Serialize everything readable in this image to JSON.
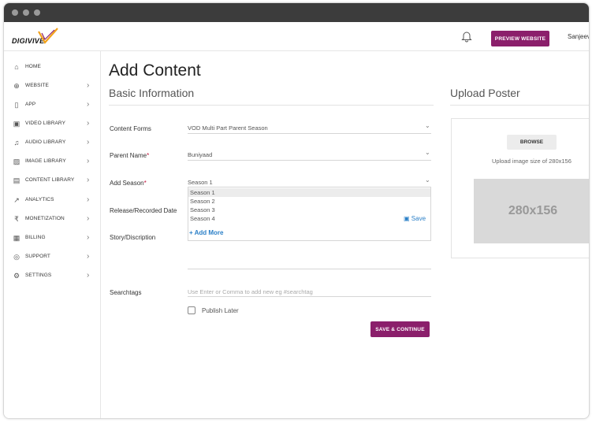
{
  "brand": {
    "name": "DIGIVIVE",
    "accent": "#8b1f6b",
    "logo_accent": "#f2a11a"
  },
  "topbar": {
    "preview_label": "PREVIEW WEBSITE",
    "user_name": "Sanjeev"
  },
  "sidebar": {
    "items": [
      {
        "label": "HOME",
        "icon": "home-icon",
        "glyph": "⌂",
        "chevron": ""
      },
      {
        "label": "WEBSITE",
        "icon": "globe-icon",
        "glyph": "⊕",
        "chevron": "›"
      },
      {
        "label": "APP",
        "icon": "mobile-icon",
        "glyph": "▯",
        "chevron": "›"
      },
      {
        "label": "VIDEO LIBRARY",
        "icon": "video-icon",
        "glyph": "▣",
        "chevron": "›"
      },
      {
        "label": "AUDIO LIBRARY",
        "icon": "music-icon",
        "glyph": "♫",
        "chevron": "›"
      },
      {
        "label": "IMAGE LIBRARY",
        "icon": "image-icon",
        "glyph": "▨",
        "chevron": "›"
      },
      {
        "label": "CONTENT LIBRARY",
        "icon": "content-icon",
        "glyph": "▤",
        "chevron": "›"
      },
      {
        "label": "ANALYTICS",
        "icon": "analytics-icon",
        "glyph": "↗",
        "chevron": "›"
      },
      {
        "label": "MONETIZATION",
        "icon": "rupee-icon",
        "glyph": "₹",
        "chevron": "›"
      },
      {
        "label": "BILLING",
        "icon": "billing-icon",
        "glyph": "▦",
        "chevron": "›"
      },
      {
        "label": "SUPPORT",
        "icon": "support-icon",
        "glyph": "◎",
        "chevron": "›"
      },
      {
        "label": "SETTINGS",
        "icon": "gear-icon",
        "glyph": "⚙",
        "chevron": "›"
      }
    ]
  },
  "main": {
    "title": "Add Content",
    "basic_info_title": "Basic Information",
    "upload_title": "Upload Poster",
    "form": {
      "content_forms": {
        "label": "Content Forms",
        "value": "VOD Multi Part Parent Season"
      },
      "parent_name": {
        "label": "Parent Name",
        "required_mark": "*",
        "value": "Buniyaad"
      },
      "add_season": {
        "label": "Add Season",
        "required_mark": "*",
        "value": "Season 1"
      },
      "release_date": {
        "label": "Release/Recorded Date"
      },
      "story": {
        "label": "Story/Discription"
      },
      "searchtags": {
        "label": "Searchtags",
        "placeholder": "Use Enter or Comma to add new eg #searchtag"
      }
    },
    "season_dropdown": {
      "options": [
        "Season 1",
        "Season 2",
        "Season 3",
        "Season 4"
      ],
      "save_label": "Save",
      "add_more_label": "+ Add More"
    },
    "publish_later_label": "Publish Later",
    "submit_label": "SAVE & CONTINUE",
    "poster": {
      "browse_label": "BROWSE",
      "hint": "Upload image size of 280x156",
      "placeholder": "280x156"
    }
  }
}
